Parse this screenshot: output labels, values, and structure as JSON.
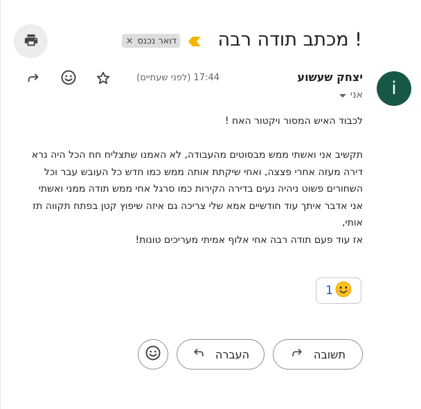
{
  "email": {
    "subject": "מכתב תודה רבה !",
    "label": "דואר נכנס",
    "label_remove": "×",
    "sender": {
      "name": "יצחק שעשוע",
      "avatar_letter": "i",
      "avatar_color": "#175747"
    },
    "recipient": "אני",
    "timestamp": "17:44 (לפני שעתיים)",
    "body": [
      "לכבוד האיש המסור ויקטור האח !",
      "",
      "תקשיב אני ואשתי ממש מבסוטים מהעבודה, לא האמנו שתצליח חח הכל היה נרא",
      "דירה מעזה אחרי פצצה, ואחי שיקתת אותה ממש כמו חדש כל העובש עבר וכל",
      "השחורים פשוט ניהיה נעים בדירה הקירות כמו סרגל אחי ממש תודה ממני ואשתי",
      "אני אדבר איתך עוד חודשיים אמא שלי צריכה גם איזה שיפוץ קטן בפתח תקווה תז",
      "אותי,",
      "אז עוד פעם תודה רבה אחי אלוף אמיתי מעריכים טונות!"
    ],
    "reaction": {
      "emoji": "😊",
      "count": "1"
    }
  },
  "actions": {
    "reply_label": "תשובה",
    "forward_label": "העברה"
  },
  "icons": {
    "print": "print-icon",
    "importance": "importance-marker-icon",
    "star": "star-icon",
    "emoji": "emoji-icon",
    "reply": "reply-icon",
    "forward": "forward-icon"
  },
  "colors": {
    "importance": "#f4b400",
    "link_blue": "#0b57d0"
  }
}
